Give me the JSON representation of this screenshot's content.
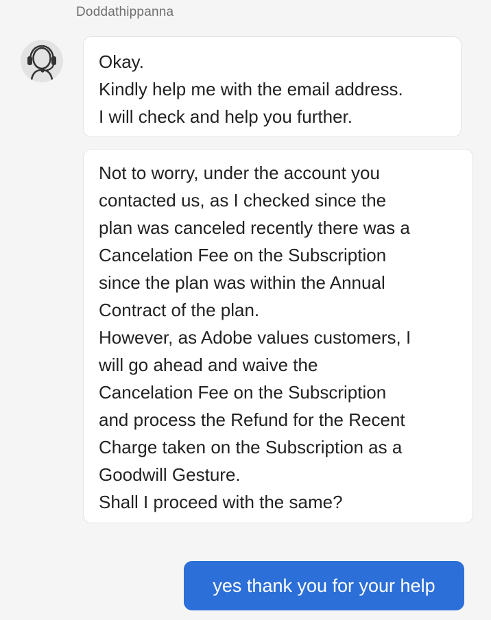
{
  "agent": {
    "name": "Doddathippanna",
    "avatar_icon": "headset-icon"
  },
  "messages": {
    "agent_1": [
      "Okay.",
      "Kindly help me with the email address.",
      "I will check and help you further."
    ],
    "agent_2": [
      "Not to worry, under the account you",
      "contacted us, as I checked since the",
      "plan was canceled recently there was a",
      "Cancelation Fee on the Subscription",
      "since the plan was within the Annual",
      "Contract of the plan.",
      "However, as Adobe values customers, I",
      "will go ahead and waive the",
      "Cancelation Fee on the Subscription",
      "and process the Refund for the Recent",
      "Charge taken on the Subscription as a",
      "Goodwill Gesture.",
      "Shall I proceed with the same?"
    ],
    "user_1": "yes thank you for your help"
  },
  "colors": {
    "background": "#f5f5f5",
    "agent_bubble": "#ffffff",
    "user_bubble": "#2d6fd8",
    "name_text": "#6e6e6e"
  }
}
